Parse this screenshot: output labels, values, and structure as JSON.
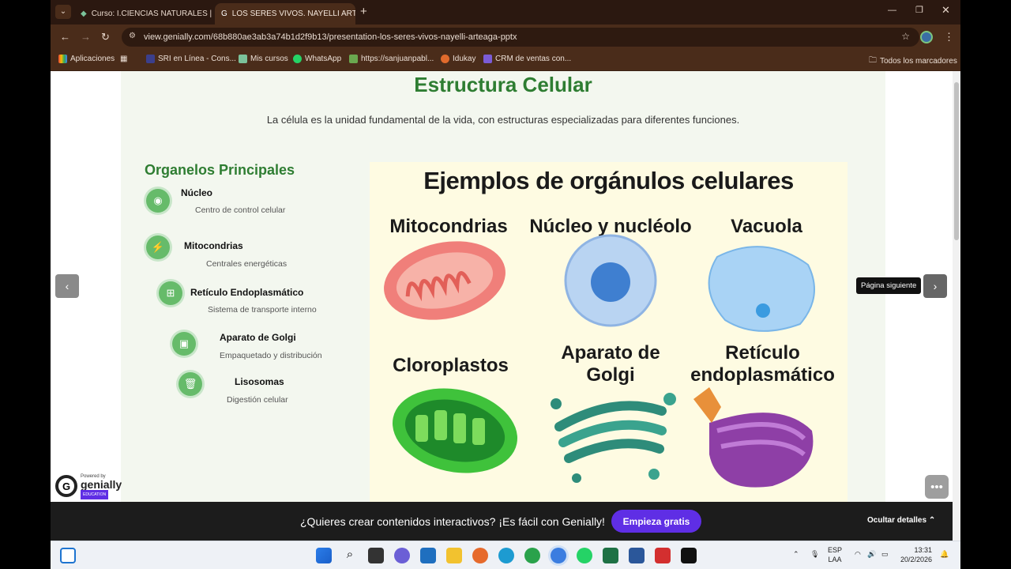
{
  "browser": {
    "tabs": [
      {
        "title": "Curso: I.CIENCIAS NATURALES |",
        "active": false
      },
      {
        "title": "LOS SERES VIVOS. NAYELLI ART",
        "active": true
      }
    ],
    "url": "view.genially.com/68b880ae3ab3a74b1d2f9b13/presentation-los-seres-vivos-nayelli-arteaga-pptx",
    "bookmarks": [
      "Aplicaciones",
      "SRI en Línea - Cons...",
      "Mis cursos",
      "WhatsApp",
      "https://sanjuanpabl...",
      "Idukay",
      "CRM de ventas con..."
    ],
    "all_bookmarks": "Todos los marcadores"
  },
  "slide": {
    "title": "Estructura Celular",
    "subtitle": "La célula es la unidad fundamental de la vida, con estructuras especializadas para diferentes funciones.",
    "organelles_heading": "Organelos Principales",
    "organelles": [
      {
        "name": "Núcleo",
        "desc": "Centro de control celular",
        "icon": "circle-dot-icon"
      },
      {
        "name": "Mitocondrias",
        "desc": "Centrales energéticas",
        "icon": "bolt-icon"
      },
      {
        "name": "Retículo Endoplasmático",
        "desc": "Sistema de transporte interno",
        "icon": "network-icon"
      },
      {
        "name": "Aparato de Golgi",
        "desc": "Empaquetado y distribución",
        "icon": "box-icon"
      },
      {
        "name": "Lisosomas",
        "desc": "Digestión celular",
        "icon": "trash-icon"
      }
    ],
    "poster": {
      "title": "Ejemplos de orgánulos celulares",
      "labels": [
        "Mitocondrias",
        "Núcleo y nucléolo",
        "Vacuola",
        "Cloroplastos",
        "Aparato de Golgi",
        "Retículo endoplasmático"
      ]
    }
  },
  "viewer": {
    "tooltip": "Página siguiente",
    "powered_by": "Powered by",
    "brand": "genially",
    "brand_tag": "EDUCATION"
  },
  "promo": {
    "text": "¿Quieres crear contenidos interactivos? ¡Es fácil con Genially!",
    "cta": "Empieza gratis",
    "hide": "Ocultar detalles"
  },
  "taskbar": {
    "lang_top": "ESP",
    "lang_bottom": "LAA",
    "time": "13:31",
    "date": "20/2/2026"
  }
}
